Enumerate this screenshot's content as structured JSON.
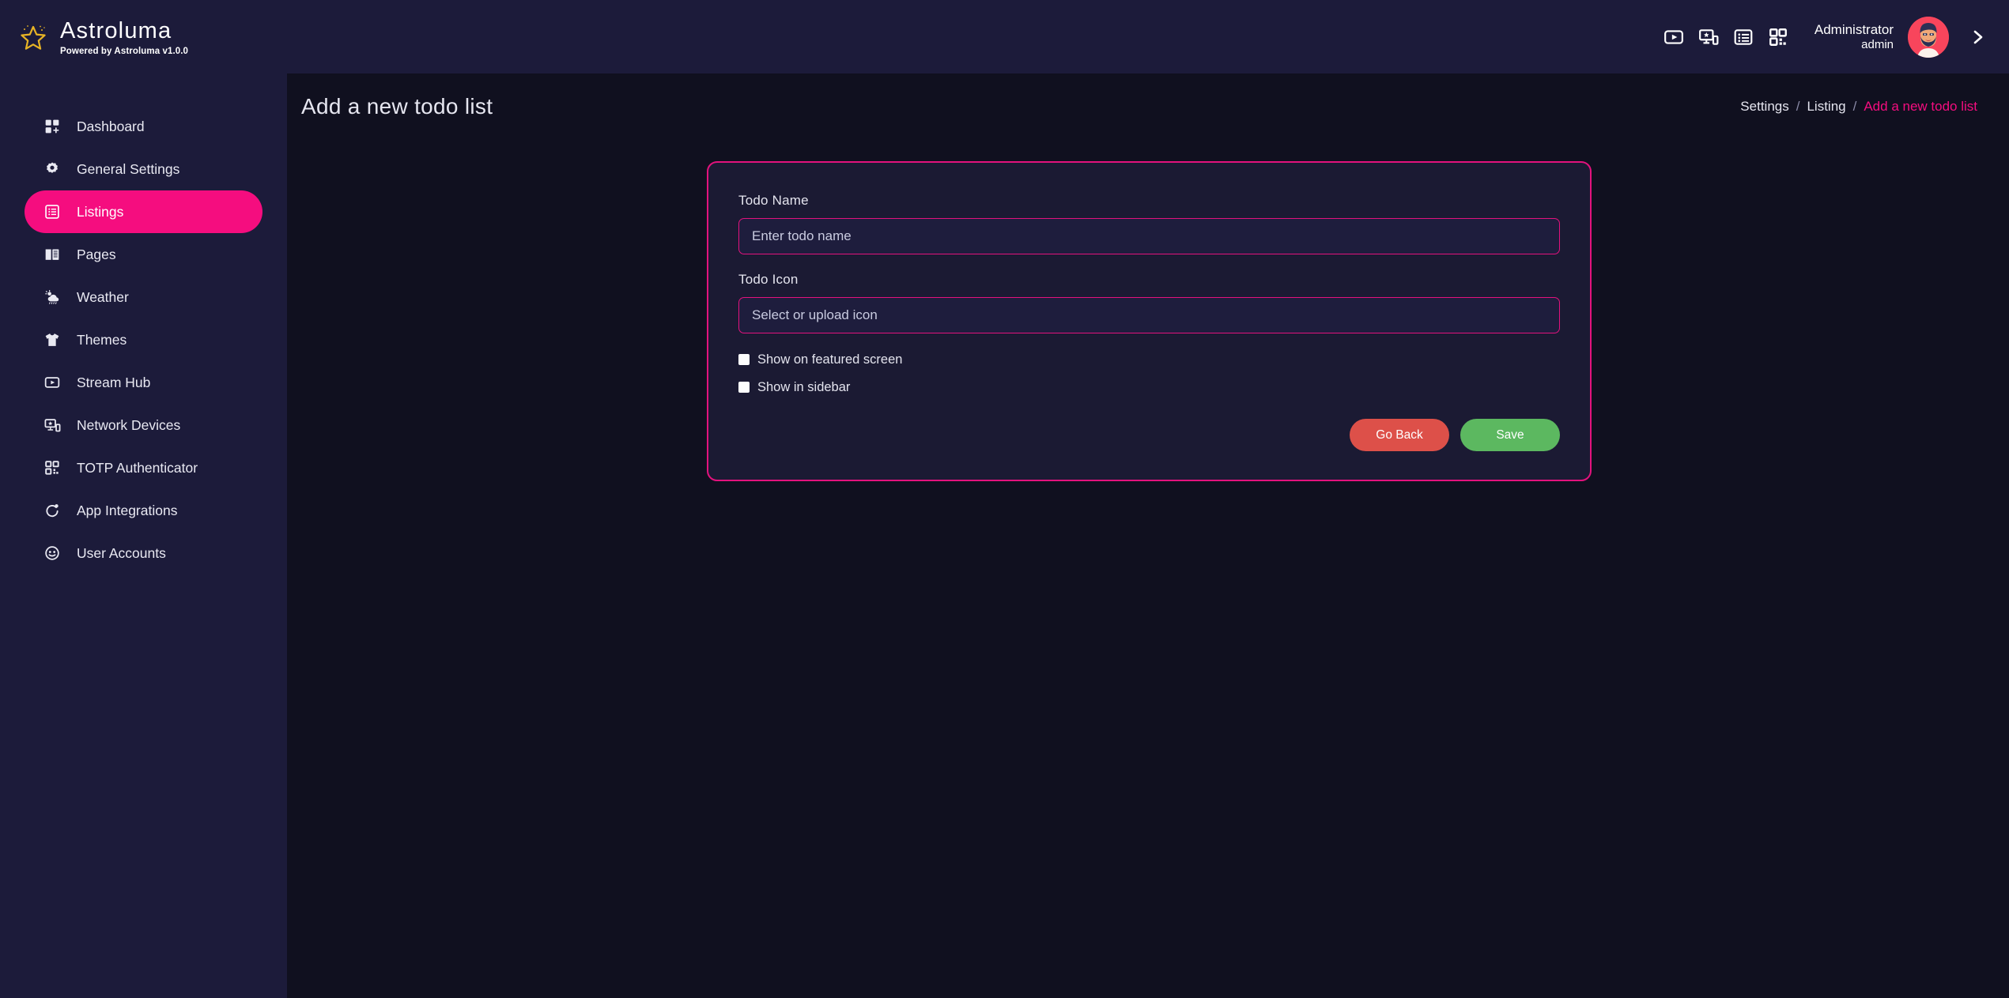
{
  "brand": {
    "title": "Astroluma",
    "subtitle": "Powered by Astroluma v1.0.0",
    "logo_icon": "star-icon"
  },
  "header": {
    "icons": [
      {
        "name": "video-play-icon",
        "label": "Video"
      },
      {
        "name": "screen-cast-icon",
        "label": "Devices"
      },
      {
        "name": "list-icon",
        "label": "Listings"
      },
      {
        "name": "qr-code-icon",
        "label": "QR Code"
      }
    ],
    "user": {
      "role": "Administrator",
      "username": "admin",
      "avatar": "user-avatar",
      "expand_icon": "chevron-right-icon"
    }
  },
  "sidebar": {
    "items": [
      {
        "label": "Dashboard",
        "icon": "dashboard-grid-icon",
        "active": false
      },
      {
        "label": "General Settings",
        "icon": "gear-icon",
        "active": false
      },
      {
        "label": "Listings",
        "icon": "list-box-icon",
        "active": true
      },
      {
        "label": "Pages",
        "icon": "book-icon",
        "active": false
      },
      {
        "label": "Weather",
        "icon": "cloud-rain-sun-icon",
        "active": false
      },
      {
        "label": "Themes",
        "icon": "tshirt-icon",
        "active": false
      },
      {
        "label": "Stream Hub",
        "icon": "video-play-icon",
        "active": false
      },
      {
        "label": "Network Devices",
        "icon": "screen-cast-icon",
        "active": false
      },
      {
        "label": "TOTP Authenticator",
        "icon": "qr-code-icon",
        "active": false
      },
      {
        "label": "App Integrations",
        "icon": "refresh-dot-icon",
        "active": false
      },
      {
        "label": "User Accounts",
        "icon": "user-face-icon",
        "active": false
      }
    ]
  },
  "page": {
    "title": "Add a new todo list",
    "breadcrumb": [
      {
        "label": "Settings",
        "current": false
      },
      {
        "label": "Listing",
        "current": false
      },
      {
        "label": "Add a new todo list",
        "current": true
      }
    ],
    "breadcrumb_separator": "/"
  },
  "form": {
    "todo_name": {
      "label": "Todo Name",
      "placeholder": "Enter todo name",
      "value": ""
    },
    "todo_icon": {
      "label": "Todo Icon",
      "placeholder": "Select or upload icon",
      "value": ""
    },
    "checkboxes": [
      {
        "label": "Show on featured screen",
        "checked": false
      },
      {
        "label": "Show in sidebar",
        "checked": false
      }
    ],
    "buttons": {
      "back_label": "Go Back",
      "save_label": "Save"
    }
  },
  "colors": {
    "accent_pink": "#f50d7f",
    "border_pink": "#e3127d",
    "sidebar_bg": "#1c1b3a",
    "content_bg": "#10101f",
    "card_bg": "#1b1a33",
    "btn_back": "#dd5049",
    "btn_save": "#5cb860",
    "logo_gold": "#e8b425"
  }
}
